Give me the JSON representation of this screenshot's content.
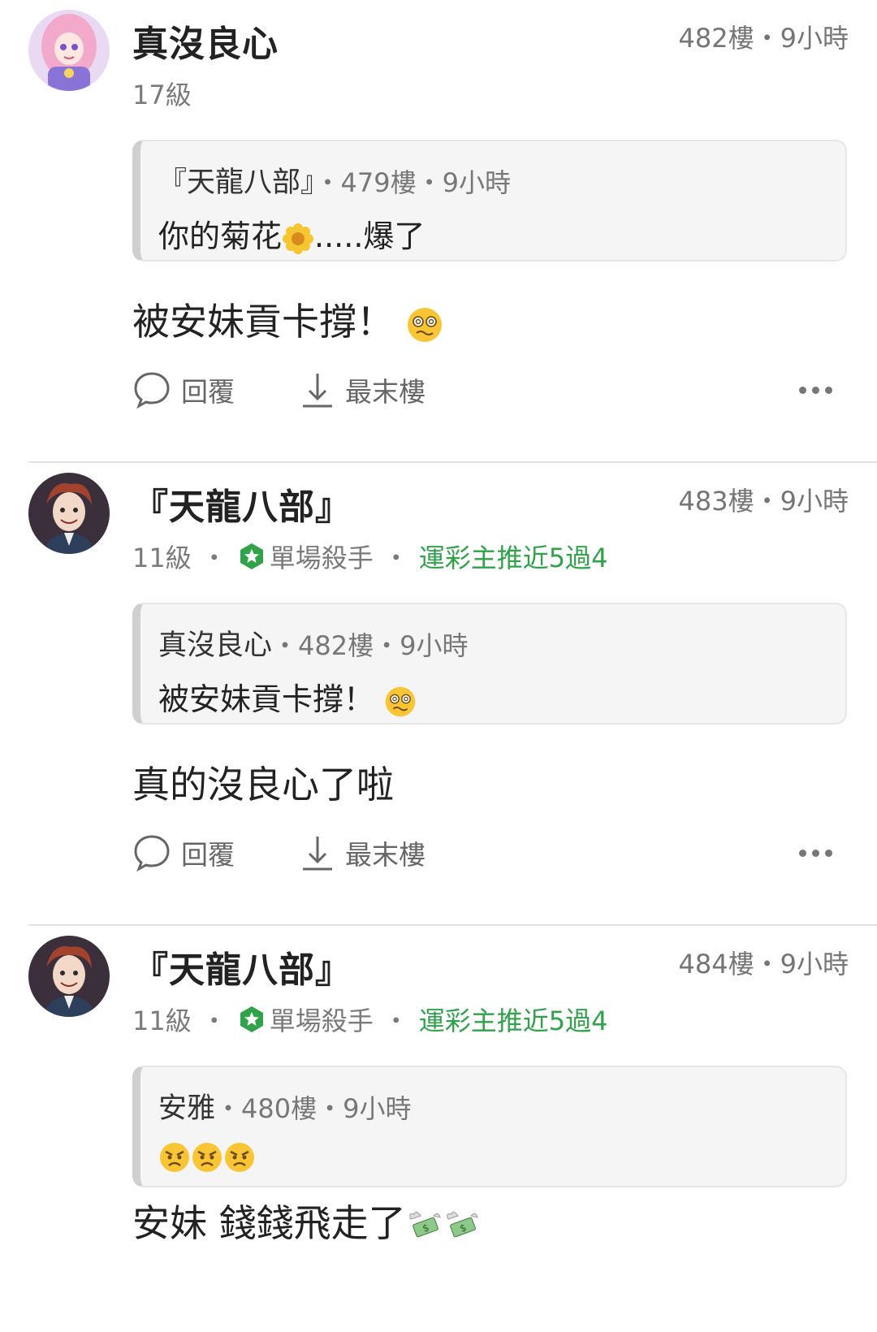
{
  "posts": [
    {
      "username": "真沒良心",
      "floor_time": "482樓・9小時",
      "level": "17級",
      "badge": "",
      "badge_extra": "",
      "quote": {
        "author": "『天龍八部』",
        "meta": "・479樓・9小時",
        "text": "你的菊花",
        "text_after": ".....爆了",
        "emoji": "flower-icon"
      },
      "content": "被安妹貢卡撐！",
      "content_emoji": "dizzy-face-icon",
      "actions": {
        "reply": "回覆",
        "last": "最末樓"
      }
    },
    {
      "username": "『天龍八部』",
      "floor_time": "483樓・9小時",
      "level": "11級",
      "badge": "單場殺手",
      "badge_extra": "運彩主推近5過4",
      "quote": {
        "author": "真沒良心",
        "meta": "・482樓・9小時",
        "text": "被安妹貢卡撐！",
        "text_after": "",
        "emoji": "dizzy-face-icon"
      },
      "content": "真的沒良心了啦",
      "content_emoji": "",
      "actions": {
        "reply": "回覆",
        "last": "最末樓"
      }
    },
    {
      "username": "『天龍八部』",
      "floor_time": "484樓・9小時",
      "level": "11級",
      "badge": "單場殺手",
      "badge_extra": "運彩主推近5過4",
      "quote": {
        "author": "安雅",
        "meta": "・480樓・9小時",
        "text": "",
        "text_after": "",
        "emoji": "angry-face-icon"
      },
      "content": "安妹 錢錢飛走了",
      "content_emoji": "money-wings-icon",
      "actions": {
        "reply": "回覆",
        "last": "最末樓"
      }
    }
  ],
  "colors": {
    "badge_green": "#2fa24a",
    "meta_gray": "#757575"
  }
}
